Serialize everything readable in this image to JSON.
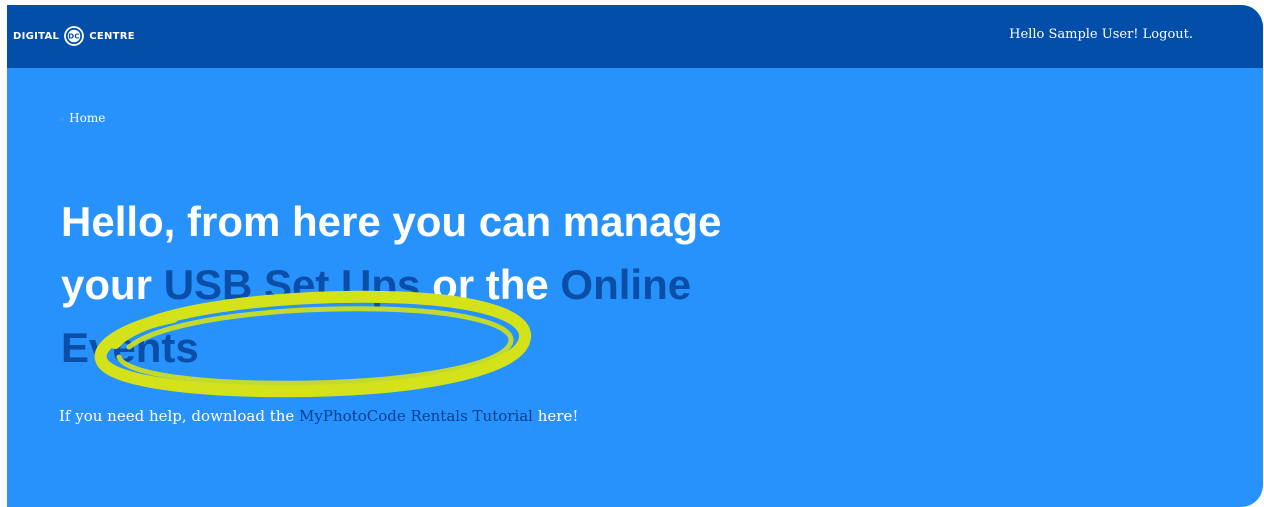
{
  "header": {
    "logo": {
      "left_text": "DIGITAL",
      "badge_text": "DC",
      "right_text": "CENTRE"
    },
    "greeting": "Hello Sample User!",
    "logout_label": "Logout."
  },
  "breadcrumb": {
    "separator": "»",
    "home_label": "Home"
  },
  "headline": {
    "part1": "Hello, from here you can manage your ",
    "link_usb": "USB Set Ups",
    "part2": " or the ",
    "link_events": "Online Events"
  },
  "help": {
    "prefix": "If you need help, download the ",
    "link": "MyPhotoCode Rentals Tutorial",
    "suffix": " here!"
  },
  "colors": {
    "topbar": "#024ea9",
    "page_background": "#2792fc",
    "link_text": "#0b4ea8",
    "highlight_marker": "#d4e21a"
  },
  "icons": {
    "logo_mark": "dc-logo-icon"
  }
}
